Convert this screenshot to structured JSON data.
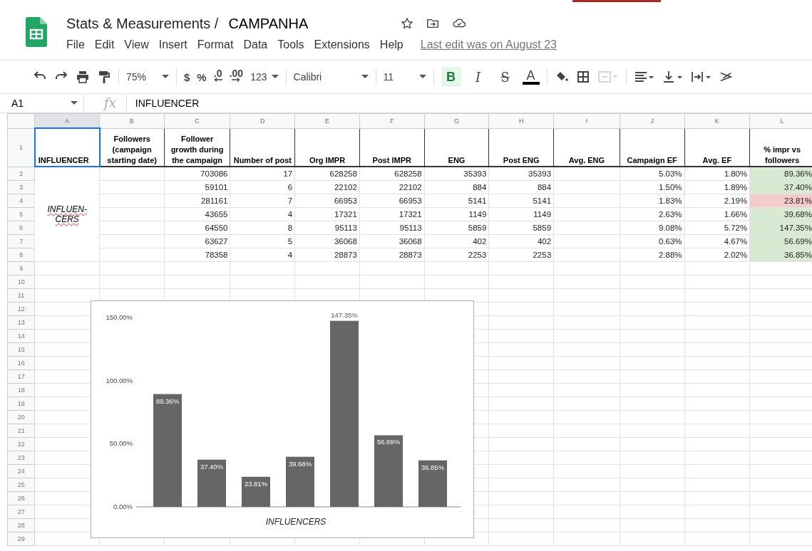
{
  "document": {
    "title": "Stats & Measurements /",
    "sheet_name": "CAMPANHA",
    "last_edit": "Last edit was on August 23"
  },
  "menu": [
    "File",
    "Edit",
    "View",
    "Insert",
    "Format",
    "Data",
    "Tools",
    "Extensions",
    "Help"
  ],
  "toolbar": {
    "zoom": "75%",
    "currency": "$",
    "percent": "%",
    "decrease_decimals": ".0",
    "increase_decimals": ".00",
    "number_format": "123",
    "font": "Calibri",
    "font_size": "11",
    "format_buttons": [
      {
        "kind": "bold",
        "label": "B",
        "selected": true
      },
      {
        "kind": "italic",
        "label": "I",
        "selected": false
      },
      {
        "kind": "strike",
        "label": "S",
        "selected": false
      },
      {
        "kind": "color",
        "label": "A",
        "selected": false,
        "color": "#000000"
      }
    ]
  },
  "formula_bar": {
    "cell": "A1",
    "fx": "fx",
    "value": "INFLUENCER"
  },
  "columns": [
    {
      "letter": "A",
      "selected": true
    },
    {
      "letter": "B",
      "selected": false
    },
    {
      "letter": "C",
      "selected": false
    },
    {
      "letter": "D",
      "selected": false
    },
    {
      "letter": "E",
      "selected": false
    },
    {
      "letter": "F",
      "selected": false
    },
    {
      "letter": "G",
      "selected": false
    },
    {
      "letter": "H",
      "selected": false
    },
    {
      "letter": "I",
      "selected": false
    },
    {
      "letter": "J",
      "selected": false
    },
    {
      "letter": "K",
      "selected": false
    },
    {
      "letter": "L",
      "selected": false
    }
  ],
  "row_numbers": [
    "1",
    "2",
    "3",
    "4",
    "5",
    "6",
    "7",
    "8",
    "9",
    "10",
    "11",
    "12",
    "13",
    "14",
    "15",
    "16",
    "17",
    "18",
    "19",
    "20",
    "21",
    "22",
    "23",
    "24",
    "25",
    "26",
    "27",
    "28",
    "29"
  ],
  "headers": [
    "INFLUENCER",
    "Followers (campaign starting date)",
    "Follower growth during the campaign",
    "Number of post",
    "Org IMPR",
    "Post IMPR",
    "ENG",
    "Post ENG",
    "Avg. ENG",
    "Campaign EF",
    "Avg. EF",
    "% impr vs followers"
  ],
  "group_label": "INFLUEN-CERS",
  "rows": [
    {
      "follower_growth": "703086",
      "posts": "17",
      "org_impr": "628258",
      "post_impr": "628258",
      "eng": "35393",
      "post_eng": "35393",
      "campaign_ef": "5.03%",
      "avg_ef": "1.80%",
      "impr_vs_followers": "89.36%",
      "color": "#d9ead3"
    },
    {
      "follower_growth": "59101",
      "posts": "6",
      "org_impr": "22102",
      "post_impr": "22102",
      "eng": "884",
      "post_eng": "884",
      "campaign_ef": "1.50%",
      "avg_ef": "1.89%",
      "impr_vs_followers": "37.40%",
      "color": "#d9ead3"
    },
    {
      "follower_growth": "281161",
      "posts": "7",
      "org_impr": "66953",
      "post_impr": "66953",
      "eng": "5141",
      "post_eng": "5141",
      "campaign_ef": "1.83%",
      "avg_ef": "2.19%",
      "impr_vs_followers": "23.81%",
      "color": "#f4cccc"
    },
    {
      "follower_growth": "43655",
      "posts": "4",
      "org_impr": "17321",
      "post_impr": "17321",
      "eng": "1149",
      "post_eng": "1149",
      "campaign_ef": "2.63%",
      "avg_ef": "1.66%",
      "impr_vs_followers": "39.68%",
      "color": "#d9ead3"
    },
    {
      "follower_growth": "64550",
      "posts": "8",
      "org_impr": "95113",
      "post_impr": "95113",
      "eng": "5859",
      "post_eng": "5859",
      "campaign_ef": "9.08%",
      "avg_ef": "5.72%",
      "impr_vs_followers": "147.35%",
      "color": "#d9ead3"
    },
    {
      "follower_growth": "63627",
      "posts": "5",
      "org_impr": "36068",
      "post_impr": "36068",
      "eng": "402",
      "post_eng": "402",
      "campaign_ef": "0.63%",
      "avg_ef": "4.67%",
      "impr_vs_followers": "56.69%",
      "color": "#d9ead3"
    },
    {
      "follower_growth": "78358",
      "posts": "4",
      "org_impr": "28873",
      "post_impr": "28873",
      "eng": "2253",
      "post_eng": "2253",
      "campaign_ef": "2.88%",
      "avg_ef": "2.02%",
      "impr_vs_followers": "36.85%",
      "color": "#d9ead3"
    }
  ],
  "chart_data": {
    "type": "bar",
    "xlabel": "INFLUENCERS",
    "ylim": [
      0,
      150
    ],
    "yticks": [
      {
        "value": 0,
        "label": "0.00%"
      },
      {
        "value": 50,
        "label": "50.00%"
      },
      {
        "value": 100,
        "label": "100.00%"
      },
      {
        "value": 150,
        "label": "150.00%"
      }
    ],
    "series": [
      {
        "color": "#666666",
        "values": [
          89.36,
          37.4,
          23.81,
          39.68,
          147.35,
          56.69,
          36.85
        ]
      }
    ],
    "value_labels": [
      "89.36%",
      "37.40%",
      "23.81%",
      "39.68%",
      "147.35%",
      "56.69%",
      "36.85%"
    ]
  }
}
